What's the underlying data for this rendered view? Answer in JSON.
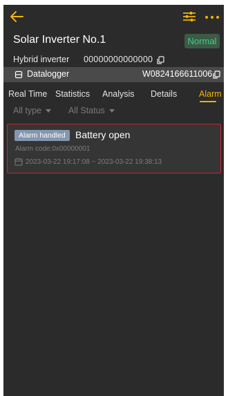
{
  "header": {
    "device_name": "Solar Inverter No.1",
    "status": "Normal",
    "device_type": "Hybrid inverter",
    "device_sn": "00000000000000",
    "datalogger_label": "Datalogger",
    "datalogger_sn": "W0824166611006"
  },
  "icons": {
    "back": "back-arrow-icon",
    "filter": "filter-sliders-icon",
    "more": "more-dots-icon",
    "copy": "copy-icon",
    "datalogger": "datalogger-icon",
    "calendar": "calendar-icon"
  },
  "tabs": [
    {
      "label": "Real Time"
    },
    {
      "label": "Statistics"
    },
    {
      "label": "Analysis"
    },
    {
      "label": "Details"
    },
    {
      "label": "Alarm",
      "active": true
    }
  ],
  "filters": {
    "type": "All type",
    "status": "All Status"
  },
  "alarms": [
    {
      "status": "Alarm handled",
      "title": "Battery open",
      "code": "Alarm code:0x00000001",
      "time": "2023-03-22 19:17:08 ~ 2023-03-22 19:38:13"
    }
  ],
  "colors": {
    "background": "#2b2b2b",
    "accent": "#f5b400",
    "status_normal": "#3fd08a",
    "alarm_border": "#d0252b",
    "alarm_badge": "#8596b0"
  }
}
